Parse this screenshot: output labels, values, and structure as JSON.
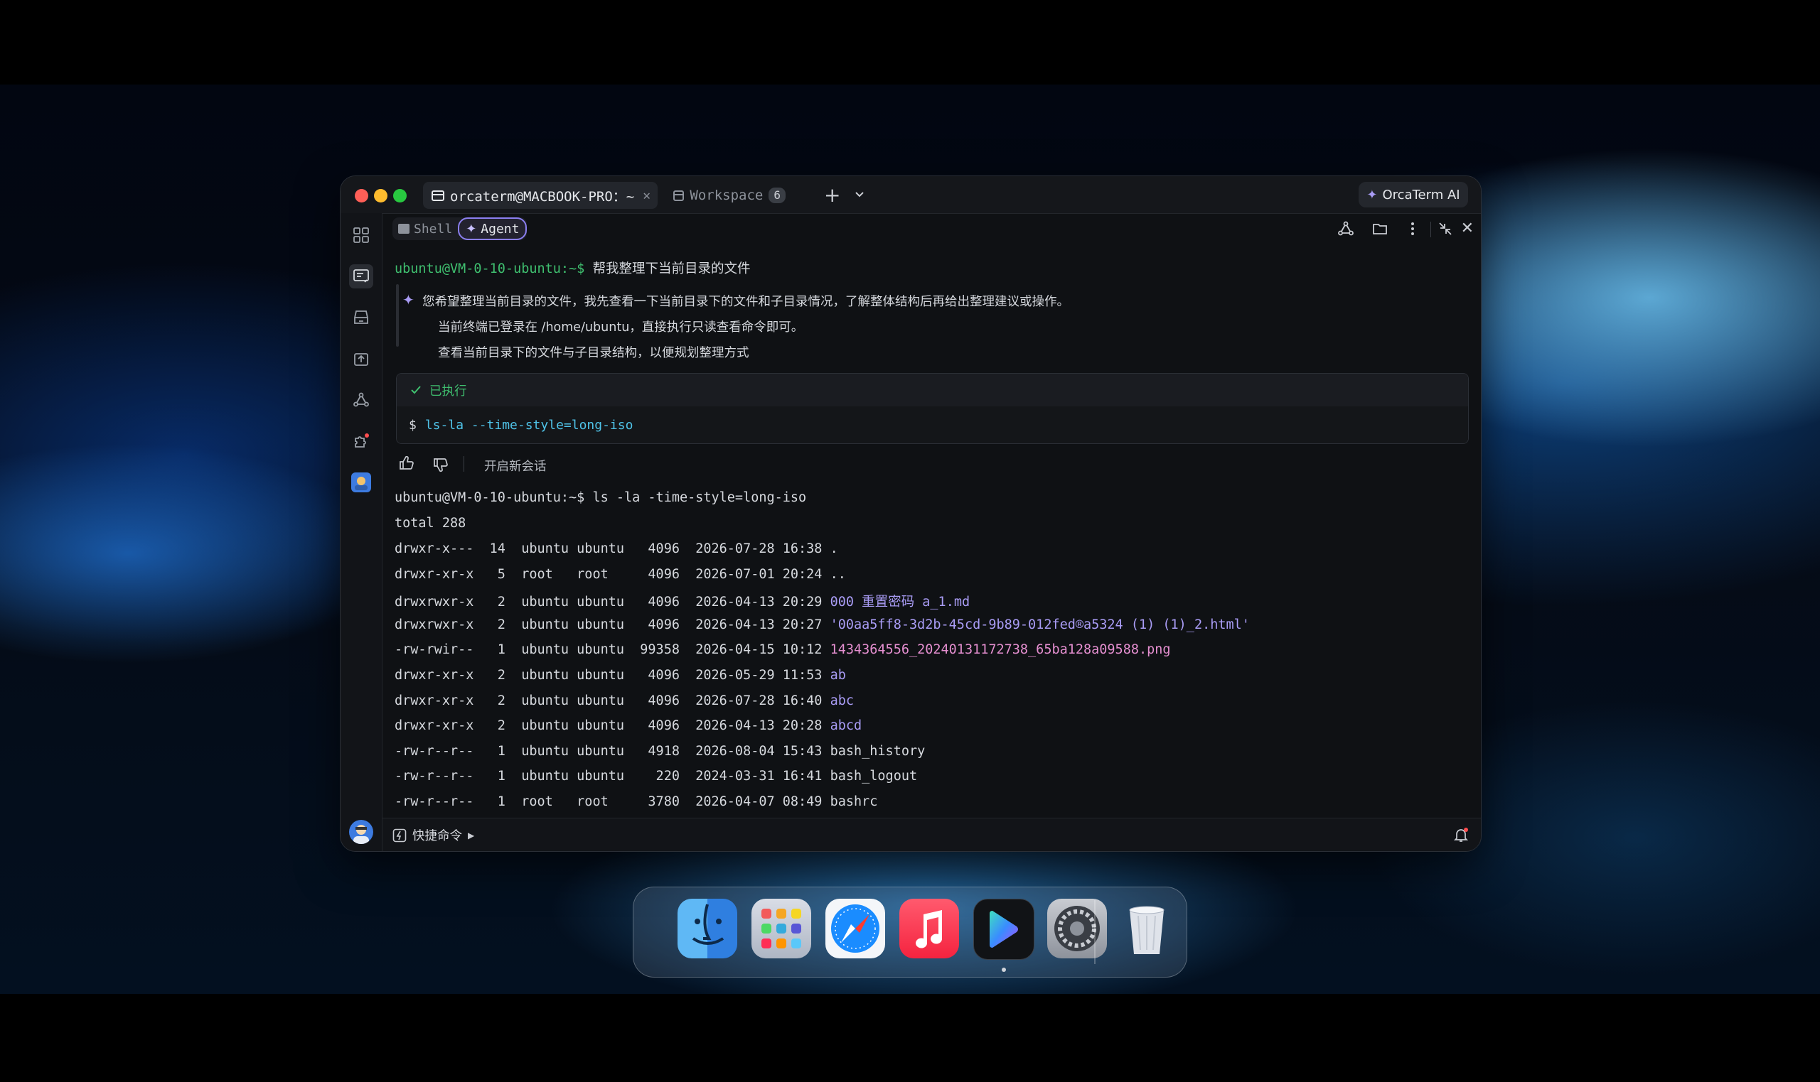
{
  "window": {
    "tabs": [
      {
        "label": "orcaterm@MACBOOK-PRO：~",
        "active": true
      },
      {
        "label": "Workspace",
        "badge": "6",
        "active": false
      }
    ],
    "ai_button": "OrcaTerm AI"
  },
  "mode_toggle": {
    "shell": "Shell",
    "agent": "Agent",
    "selected": "Agent"
  },
  "session": {
    "prompt": "ubuntu@VM-0-10-ubuntu:~$",
    "user_request": "帮我整理下当前目录的文件",
    "agent_messages": [
      "您希望整理当前目录的文件，我先查看一下当前目录下的文件和子目录情况，了解整体结构后再给出整理建议或操作。",
      "当前终端已登录在 /home/ubuntu，直接执行只读查看命令即可。",
      "查看当前目录下的文件与子目录结构，以便规划整理方式"
    ],
    "exec_status": "已执行",
    "exec_prompt": "$",
    "exec_command": "ls-la --time-style=long-iso",
    "new_session": "开启新会话",
    "command_line": "ls -la -time-style=long-iso",
    "total": "total 288",
    "listing": [
      {
        "perm": "drwxr-x---",
        "links": "14",
        "user": "ubuntu",
        "group": "ubuntu",
        "size": "4096",
        "date": "2026-07-28 16:38",
        "name": ".",
        "kind": "plain"
      },
      {
        "perm": "drwxr-xr-x",
        "links": "5",
        "user": "root",
        "group": "root",
        "size": "4096",
        "date": "2026-07-01 20:24",
        "name": "..",
        "kind": "plain"
      },
      {
        "perm": "drwxrwxr-x",
        "links": "2",
        "user": "ubuntu",
        "group": "ubuntu",
        "size": "4096",
        "date": "2026-04-13 20:29",
        "name": "000 重置密码 a_1.md",
        "kind": "dir"
      },
      {
        "perm": "drwxrwxr-x",
        "links": "2",
        "user": "ubuntu",
        "group": "ubuntu",
        "size": "4096",
        "date": "2026-04-13 20:27",
        "name": "'00aa5ff8-3d2b-45cd-9b89-012fed®a5324 (1) (1)_2.html'",
        "kind": "dir"
      },
      {
        "perm": "-rw-rwir--",
        "links": "1",
        "user": "ubuntu",
        "group": "ubuntu",
        "size": "99358",
        "date": "2026-04-15 10:12",
        "name": "1434364556_20240131172738_65ba128a09588.png",
        "kind": "image"
      },
      {
        "perm": "drwxr-xr-x",
        "links": "2",
        "user": "ubuntu",
        "group": "ubuntu",
        "size": "4096",
        "date": "2026-05-29 11:53",
        "name": "ab",
        "kind": "dir"
      },
      {
        "perm": "drwxr-xr-x",
        "links": "2",
        "user": "ubuntu",
        "group": "ubuntu",
        "size": "4096",
        "date": "2026-07-28 16:40",
        "name": "abc",
        "kind": "dir"
      },
      {
        "perm": "drwxr-xr-x",
        "links": "2",
        "user": "ubuntu",
        "group": "ubuntu",
        "size": "4096",
        "date": "2026-04-13 20:28",
        "name": "abcd",
        "kind": "dir"
      },
      {
        "perm": "-rw-r--r--",
        "links": "1",
        "user": "ubuntu",
        "group": "ubuntu",
        "size": "4918",
        "date": "2026-08-04 15:43",
        "name": "bash_history",
        "kind": "plain"
      },
      {
        "perm": "-rw-r--r--",
        "links": "1",
        "user": "ubuntu",
        "group": "ubuntu",
        "size": "220",
        "date": "2024-03-31 16:41",
        "name": "bash_logout",
        "kind": "plain"
      },
      {
        "perm": "-rw-r--r--",
        "links": "1",
        "user": "root",
        "group": "root",
        "size": "3780",
        "date": "2026-04-07 08:49",
        "name": "bashrc",
        "kind": "plain"
      }
    ]
  },
  "footer": {
    "quick_commands": "快捷命令"
  },
  "colors": {
    "prompt_green": "#3fbf6f",
    "dir_purple": "#a99cf5",
    "image_pink": "#e58fd0",
    "command_cyan": "#4fc3e8"
  },
  "sidebar_icons": [
    "apps-icon",
    "terminal-tasks-icon",
    "storage-icon",
    "upload-icon",
    "network-icon",
    "extensions-icon",
    "ai-avatar-icon"
  ],
  "dock_apps": [
    "finder-icon",
    "launchpad-icon",
    "safari-icon",
    "music-icon",
    "orcaterm-icon",
    "system-settings-icon",
    "trash-icon"
  ]
}
